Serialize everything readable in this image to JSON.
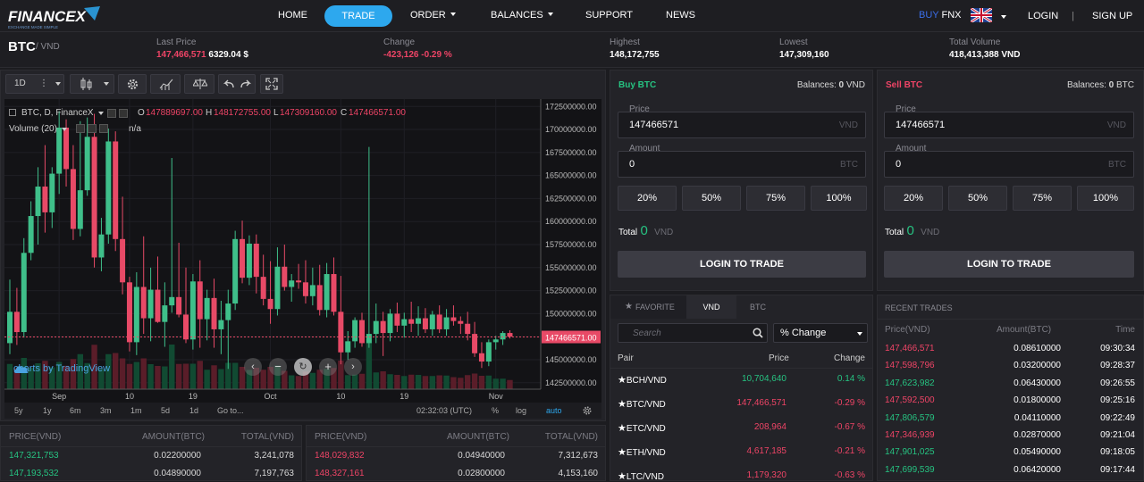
{
  "brand": {
    "name": "FINANCEX",
    "tagline": "EXCHANGE MADE SIMPLE"
  },
  "nav": {
    "home": "HOME",
    "trade": "TRADE",
    "order": "ORDER",
    "balances": "BALANCES",
    "support": "SUPPORT",
    "news": "NEWS",
    "buy_fnx_a": "BUY",
    "buy_fnx_b": "FNX",
    "login": "LOGIN",
    "divider": "|",
    "signup": "SIGN UP"
  },
  "market": {
    "pair": "BTC",
    "quote": "/ VND",
    "last_price_label": "Last Price",
    "last_price_vnd": "147,466,571",
    "last_price_usd": "6329.04 $",
    "change_label": "Change",
    "change_abs": "-423,126",
    "change_pct": "-0.29 %",
    "highest_label": "Highest",
    "highest": "148,172,755",
    "lowest_label": "Lowest",
    "lowest": "147,309,160",
    "volume_label": "Total Volume",
    "volume": "418,413,388 VND"
  },
  "toolbar": {
    "interval": "1D",
    "more": "⋮"
  },
  "chart": {
    "legend_symbol": "BTC, D, FinanceX",
    "o_label": "O",
    "o_val": "147889697.00",
    "h_label": "H",
    "h_val": "148172755.00",
    "l_label": "L",
    "l_val": "147309160.00",
    "c_label": "C",
    "c_val": "147466571.00",
    "volume_legend": "Volume (20)",
    "volume_na": "n/a",
    "brand": "charts by TradingView",
    "last_price_tag": "147466571.00",
    "x_ticks": [
      {
        "label": "Sep",
        "i": 7
      },
      {
        "label": "10",
        "i": 17
      },
      {
        "label": "19",
        "i": 26
      },
      {
        "label": "Oct",
        "i": 37
      },
      {
        "label": "10",
        "i": 47
      },
      {
        "label": "19",
        "i": 56
      },
      {
        "label": "Nov",
        "i": 69
      }
    ],
    "y_ticks": [
      "172500000.00",
      "170000000.00",
      "167500000.00",
      "165000000.00",
      "162500000.00",
      "160000000.00",
      "157500000.00",
      "155000000.00",
      "152500000.00",
      "150000000.00",
      "147500000.00",
      "145000000.00",
      "142500000.00"
    ]
  },
  "chart_data": {
    "type": "candlestick",
    "y_axis_values": [
      172500000,
      170000000,
      167500000,
      165000000,
      162500000,
      160000000,
      157500000,
      155000000,
      152500000,
      150000000,
      147500000,
      145000000,
      142500000
    ],
    "ylim": [
      141800000,
      173300000
    ],
    "last_price": 147466571,
    "candles": [
      [
        146800000,
        153700000,
        145600000,
        150200000
      ],
      [
        150200000,
        152800000,
        146600000,
        148000000
      ],
      [
        148000000,
        158200000,
        147400000,
        156600000
      ],
      [
        156600000,
        162200000,
        155800000,
        160600000
      ],
      [
        160600000,
        165900000,
        157500000,
        163800000
      ],
      [
        163800000,
        168300000,
        158800000,
        161000000
      ],
      [
        161000000,
        165900000,
        159300000,
        165200000
      ],
      [
        165200000,
        172000000,
        163000000,
        170200000
      ],
      [
        170200000,
        171100000,
        163800000,
        165700000
      ],
      [
        165700000,
        168300000,
        158000000,
        159200000
      ],
      [
        159200000,
        170900000,
        158400000,
        163400000
      ],
      [
        163400000,
        171300000,
        162800000,
        169200000
      ],
      [
        169200000,
        171700000,
        155000000,
        156100000
      ],
      [
        156100000,
        160400000,
        154600000,
        158600000
      ],
      [
        158600000,
        170100000,
        157600000,
        168700000
      ],
      [
        168700000,
        169800000,
        156800000,
        158100000
      ],
      [
        158100000,
        162700000,
        152100000,
        153400000
      ],
      [
        153400000,
        154000000,
        145900000,
        146900000
      ],
      [
        146900000,
        154500000,
        145500000,
        152900000
      ],
      [
        152900000,
        158400000,
        147800000,
        149500000
      ],
      [
        149500000,
        155000000,
        147000000,
        152600000
      ],
      [
        152600000,
        156200000,
        149000000,
        149100000
      ],
      [
        149100000,
        153400000,
        146400000,
        150900000
      ],
      [
        150900000,
        166900000,
        150100000,
        151800000
      ],
      [
        151800000,
        157700000,
        149600000,
        149900000
      ],
      [
        149900000,
        155000000,
        146800000,
        147200000
      ],
      [
        147200000,
        154300000,
        146100000,
        153500000
      ],
      [
        153500000,
        155800000,
        146300000,
        149400000
      ],
      [
        149400000,
        152600000,
        147100000,
        151700000
      ],
      [
        151700000,
        153800000,
        146300000,
        148300000
      ],
      [
        148300000,
        151400000,
        145600000,
        149300000
      ],
      [
        149300000,
        152600000,
        144000000,
        151100000
      ],
      [
        151100000,
        159000000,
        150400000,
        158100000
      ],
      [
        158100000,
        160100000,
        153300000,
        153900000
      ],
      [
        153900000,
        158500000,
        153100000,
        157600000
      ],
      [
        157600000,
        158600000,
        152200000,
        154000000
      ],
      [
        154000000,
        156400000,
        150900000,
        151600000
      ],
      [
        151600000,
        155700000,
        148900000,
        150500000
      ],
      [
        150500000,
        157200000,
        149800000,
        155100000
      ],
      [
        155100000,
        157500000,
        152500000,
        152900000
      ],
      [
        152900000,
        154300000,
        151300000,
        153600000
      ],
      [
        153600000,
        155400000,
        152700000,
        153400000
      ],
      [
        153400000,
        155800000,
        151100000,
        151900000
      ],
      [
        151900000,
        155000000,
        150900000,
        153100000
      ],
      [
        153100000,
        155300000,
        149800000,
        150400000
      ],
      [
        150400000,
        155500000,
        149600000,
        154300000
      ],
      [
        154300000,
        156100000,
        149800000,
        150200000
      ],
      [
        150200000,
        154100000,
        144500000,
        145800000
      ],
      [
        145800000,
        148100000,
        145000000,
        147000000
      ],
      [
        147000000,
        149600000,
        146300000,
        149300000
      ],
      [
        149300000,
        150100000,
        146400000,
        146800000
      ],
      [
        146800000,
        168100000,
        146300000,
        147800000
      ],
      [
        147800000,
        151100000,
        146800000,
        149200000
      ],
      [
        149200000,
        150200000,
        145400000,
        147900000
      ],
      [
        147900000,
        150500000,
        147000000,
        150000000
      ],
      [
        150000000,
        151200000,
        148000000,
        148700000
      ],
      [
        148700000,
        150100000,
        147400000,
        149400000
      ],
      [
        149400000,
        151300000,
        148000000,
        148900000
      ],
      [
        148900000,
        150800000,
        147600000,
        149500000
      ],
      [
        149500000,
        150600000,
        147900000,
        148300000
      ],
      [
        148300000,
        150300000,
        147600000,
        149900000
      ],
      [
        149900000,
        150900000,
        147900000,
        148300000
      ],
      [
        148300000,
        150500000,
        147600000,
        149600000
      ],
      [
        149600000,
        150900000,
        148700000,
        149200000
      ],
      [
        149200000,
        149700000,
        147800000,
        148900000
      ],
      [
        148900000,
        150200000,
        147100000,
        147800000
      ],
      [
        147800000,
        149100000,
        145300000,
        145700000
      ],
      [
        145700000,
        146900000,
        144100000,
        144800000
      ],
      [
        144800000,
        147200000,
        144300000,
        146900000
      ],
      [
        146900000,
        147600000,
        146100000,
        147200000
      ],
      [
        147200000,
        148100000,
        146600000,
        147900000
      ],
      [
        147900000,
        148200000,
        147300000,
        147500000
      ]
    ]
  },
  "timeframes": {
    "t5y": "5y",
    "t1y": "1y",
    "t6m": "6m",
    "t3m": "3m",
    "t1m": "1m",
    "t5d": "5d",
    "t1d": "1d",
    "goto": "Go to...",
    "clock": "02:32:03 (UTC)",
    "pct": "%",
    "log": "log",
    "auto": "auto"
  },
  "buy": {
    "title": "Buy BTC",
    "balances_label": "Balances:",
    "balances_val": "0",
    "balances_unit": "VND",
    "price_label": "Price",
    "price_val": "147466571",
    "price_unit": "VND",
    "amount_label": "Amount",
    "amount_val": "0",
    "amount_unit": "BTC",
    "p20": "20%",
    "p50": "50%",
    "p75": "75%",
    "p100": "100%",
    "total_label": "Total",
    "total_val": "0",
    "total_unit": "VND",
    "login": "LOGIN TO TRADE"
  },
  "sell": {
    "title": "Sell BTC",
    "balances_label": "Balances:",
    "balances_val": "0",
    "balances_unit": "BTC",
    "price_label": "Price",
    "price_val": "147466571",
    "price_unit": "VND",
    "amount_label": "Amount",
    "amount_val": "0",
    "amount_unit": "BTC",
    "p20": "20%",
    "p50": "50%",
    "p75": "75%",
    "p100": "100%",
    "total_label": "Total",
    "total_val": "0",
    "total_unit": "VND",
    "login": "LOGIN TO TRADE"
  },
  "pairs": {
    "tab_favorite": "FAVORITE",
    "tab_vnd": "VND",
    "tab_btc": "BTC",
    "search_placeholder": "Search",
    "sort": "% Change",
    "col_pair": "Pair",
    "col_price": "Price",
    "col_change": "Change",
    "rows": [
      {
        "name": "BCH/VND",
        "price": "10,704,640",
        "change": "0.14 %"
      },
      {
        "name": "BTC/VND",
        "price": "147,466,571",
        "change": "-0.29 %"
      },
      {
        "name": "ETC/VND",
        "price": "208,964",
        "change": "-0.67 %"
      },
      {
        "name": "ETH/VND",
        "price": "4,617,185",
        "change": "-0.21 %"
      },
      {
        "name": "LTC/VND",
        "price": "1,179,320",
        "change": "-0.63 %"
      }
    ]
  },
  "recent": {
    "title": "RECENT TRADES",
    "col_price": "Price(VND)",
    "col_amount": "Amount(BTC)",
    "col_time": "Time",
    "rows": [
      {
        "price": "147,466,571",
        "amount": "0.08610000",
        "time": "09:30:34"
      },
      {
        "price": "147,598,796",
        "amount": "0.03200000",
        "time": "09:28:37"
      },
      {
        "price": "147,623,982",
        "amount": "0.06430000",
        "time": "09:26:55"
      },
      {
        "price": "147,592,500",
        "amount": "0.01800000",
        "time": "09:25:16"
      },
      {
        "price": "147,806,579",
        "amount": "0.04110000",
        "time": "09:22:49"
      },
      {
        "price": "147,346,939",
        "amount": "0.02870000",
        "time": "09:21:04"
      },
      {
        "price": "147,901,025",
        "amount": "0.05490000",
        "time": "09:18:05"
      },
      {
        "price": "147,699,539",
        "amount": "0.06420000",
        "time": "09:17:44"
      }
    ]
  },
  "orderbook_buy": {
    "col_price": "PRICE(VND)",
    "col_amount": "AMOUNT(BTC)",
    "col_total": "TOTAL(VND)",
    "rows": [
      {
        "price": "147,321,753",
        "amount": "0.02200000",
        "total": "3,241,078"
      },
      {
        "price": "147,193,532",
        "amount": "0.04890000",
        "total": "7,197,763"
      }
    ]
  },
  "orderbook_sell": {
    "col_price": "PRICE(VND)",
    "col_amount": "AMOUNT(BTC)",
    "col_total": "TOTAL(VND)",
    "rows": [
      {
        "price": "148,029,832",
        "amount": "0.04940000",
        "total": "7,312,673"
      },
      {
        "price": "148,327,161",
        "amount": "0.02800000",
        "total": "4,153,160"
      }
    ]
  },
  "colors": {
    "accent": "#2da8ee",
    "up": "#26c281",
    "down": "#ee4466",
    "bg": "#1c1c20",
    "panel": "#232328"
  }
}
